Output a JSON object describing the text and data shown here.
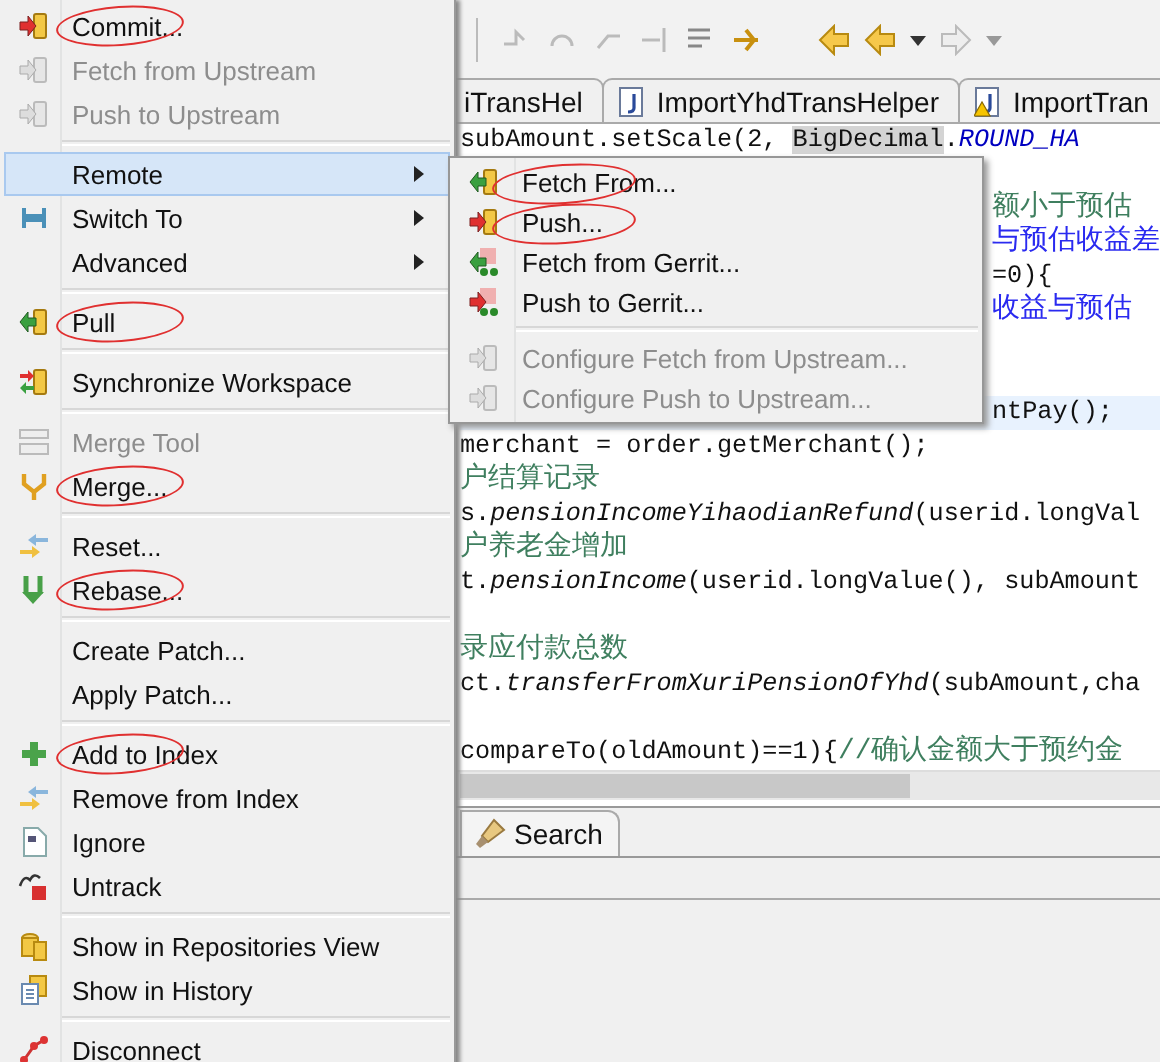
{
  "menu": {
    "items": [
      {
        "kind": "item",
        "label": "Commit...",
        "disabled": false,
        "selected": false,
        "submenu": false,
        "circled": true
      },
      {
        "kind": "item",
        "label": "Fetch from Upstream",
        "disabled": true,
        "selected": false,
        "submenu": false,
        "circled": false
      },
      {
        "kind": "item",
        "label": "Push to Upstream",
        "disabled": true,
        "selected": false,
        "submenu": false,
        "circled": false
      },
      {
        "kind": "separator"
      },
      {
        "kind": "item",
        "label": "Remote",
        "disabled": false,
        "selected": true,
        "submenu": true,
        "circled": false
      },
      {
        "kind": "item",
        "label": "Switch To",
        "disabled": false,
        "selected": false,
        "submenu": true,
        "circled": false
      },
      {
        "kind": "item",
        "label": "Advanced",
        "disabled": false,
        "selected": false,
        "submenu": true,
        "circled": false
      },
      {
        "kind": "separator"
      },
      {
        "kind": "item",
        "label": "Pull",
        "disabled": false,
        "selected": false,
        "submenu": false,
        "circled": true
      },
      {
        "kind": "separator"
      },
      {
        "kind": "item",
        "label": "Synchronize Workspace",
        "disabled": false,
        "selected": false,
        "submenu": false,
        "circled": false
      },
      {
        "kind": "separator"
      },
      {
        "kind": "item",
        "label": "Merge Tool",
        "disabled": true,
        "selected": false,
        "submenu": false,
        "circled": false
      },
      {
        "kind": "item",
        "label": "Merge...",
        "disabled": false,
        "selected": false,
        "submenu": false,
        "circled": true
      },
      {
        "kind": "separator"
      },
      {
        "kind": "item",
        "label": "Reset...",
        "disabled": false,
        "selected": false,
        "submenu": false,
        "circled": false
      },
      {
        "kind": "item",
        "label": "Rebase...",
        "disabled": false,
        "selected": false,
        "submenu": false,
        "circled": true
      },
      {
        "kind": "separator"
      },
      {
        "kind": "item",
        "label": "Create Patch...",
        "disabled": false,
        "selected": false,
        "submenu": false,
        "circled": false
      },
      {
        "kind": "item",
        "label": "Apply Patch...",
        "disabled": false,
        "selected": false,
        "submenu": false,
        "circled": false
      },
      {
        "kind": "separator"
      },
      {
        "kind": "item",
        "label": "Add to Index",
        "disabled": false,
        "selected": false,
        "submenu": false,
        "circled": true
      },
      {
        "kind": "item",
        "label": "Remove from Index",
        "disabled": false,
        "selected": false,
        "submenu": false,
        "circled": false
      },
      {
        "kind": "item",
        "label": "Ignore",
        "disabled": false,
        "selected": false,
        "submenu": false,
        "circled": false
      },
      {
        "kind": "item",
        "label": "Untrack",
        "disabled": false,
        "selected": false,
        "submenu": false,
        "circled": false
      },
      {
        "kind": "separator"
      },
      {
        "kind": "item",
        "label": "Show in Repositories View",
        "disabled": false,
        "selected": false,
        "submenu": false,
        "circled": false
      },
      {
        "kind": "item",
        "label": "Show in History",
        "disabled": false,
        "selected": false,
        "submenu": false,
        "circled": false
      },
      {
        "kind": "separator"
      },
      {
        "kind": "item",
        "label": "Disconnect",
        "disabled": false,
        "selected": false,
        "submenu": false,
        "circled": false
      }
    ]
  },
  "submenu": {
    "items": [
      {
        "kind": "item",
        "label": "Fetch From...",
        "disabled": false,
        "circled": true
      },
      {
        "kind": "item",
        "label": "Push...",
        "disabled": false,
        "circled": true
      },
      {
        "kind": "item",
        "label": "Fetch from Gerrit...",
        "disabled": false,
        "circled": false
      },
      {
        "kind": "item",
        "label": "Push to Gerrit...",
        "disabled": false,
        "circled": false
      },
      {
        "kind": "separator"
      },
      {
        "kind": "item",
        "label": "Configure Fetch from Upstream...",
        "disabled": true,
        "circled": false
      },
      {
        "kind": "item",
        "label": "Configure Push to Upstream...",
        "disabled": true,
        "circled": false
      }
    ]
  },
  "editor_tabs": [
    {
      "label": "iTransHel",
      "selected": false,
      "warning": false
    },
    {
      "label": "ImportYhdTransHelper",
      "selected": false,
      "warning": false
    },
    {
      "label": "ImportTran",
      "selected": false,
      "warning": true
    }
  ],
  "code_lines": [
    {
      "kind": "full",
      "current": false,
      "segments": [
        {
          "kind": "plain",
          "text": "subAmount.setScale(2, "
        },
        {
          "kind": "mark",
          "text": "BigDecimal"
        },
        {
          "kind": "plain",
          "text": "."
        },
        {
          "kind": "constant",
          "text": "ROUND_HA"
        }
      ]
    },
    {
      "kind": "blank",
      "current": false
    },
    {
      "kind": "partial",
      "current": false,
      "segments": [
        {
          "kind": "comment",
          "text": "额小于预估"
        }
      ]
    },
    {
      "kind": "partial",
      "current": false,
      "segments": [
        {
          "kind": "doc",
          "text": "与预估收益差"
        }
      ]
    },
    {
      "kind": "partial",
      "current": false,
      "segments": [
        {
          "kind": "plain",
          "text": "=0){"
        }
      ]
    },
    {
      "kind": "partial",
      "current": false,
      "segments": [
        {
          "kind": "doc",
          "text": "收益与预估"
        }
      ]
    },
    {
      "kind": "blank",
      "current": false
    },
    {
      "kind": "blank",
      "current": false
    },
    {
      "kind": "partial",
      "current": true,
      "segments": [
        {
          "kind": "plain",
          "text": "ntPay();"
        }
      ]
    },
    {
      "kind": "full",
      "current": false,
      "segments": [
        {
          "kind": "plain",
          "text": "merchant = order.getMerchant();"
        }
      ]
    },
    {
      "kind": "full",
      "current": false,
      "segments": [
        {
          "kind": "comment",
          "text": "户结算记录"
        }
      ]
    },
    {
      "kind": "full",
      "current": false,
      "segments": [
        {
          "kind": "plain",
          "text": "s."
        },
        {
          "kind": "italic",
          "text": "pensionIncomeYihaodianRefund"
        },
        {
          "kind": "plain",
          "text": "(userid.longVal"
        }
      ]
    },
    {
      "kind": "full",
      "current": false,
      "segments": [
        {
          "kind": "comment",
          "text": "户养老金增加"
        }
      ]
    },
    {
      "kind": "full",
      "current": false,
      "segments": [
        {
          "kind": "plain",
          "text": "t."
        },
        {
          "kind": "italic",
          "text": "pensionIncome"
        },
        {
          "kind": "plain",
          "text": "(userid.longValue(), subAmount"
        }
      ]
    },
    {
      "kind": "blank",
      "current": false
    },
    {
      "kind": "full",
      "current": false,
      "segments": [
        {
          "kind": "comment",
          "text": "录应付款总数"
        }
      ]
    },
    {
      "kind": "full",
      "current": false,
      "segments": [
        {
          "kind": "plain",
          "text": "ct."
        },
        {
          "kind": "italic",
          "text": "transferFromXuriPensionOfYhd"
        },
        {
          "kind": "plain",
          "text": "(subAmount,cha"
        }
      ]
    },
    {
      "kind": "blank",
      "current": false
    },
    {
      "kind": "full",
      "current": false,
      "segments": [
        {
          "kind": "plain",
          "text": "compareTo(oldAmount)==1){"
        },
        {
          "kind": "comment",
          "text": "//确认金额大于预约金"
        }
      ]
    }
  ],
  "bottom_tabs": [
    {
      "label": "Search",
      "selected": true
    }
  ]
}
